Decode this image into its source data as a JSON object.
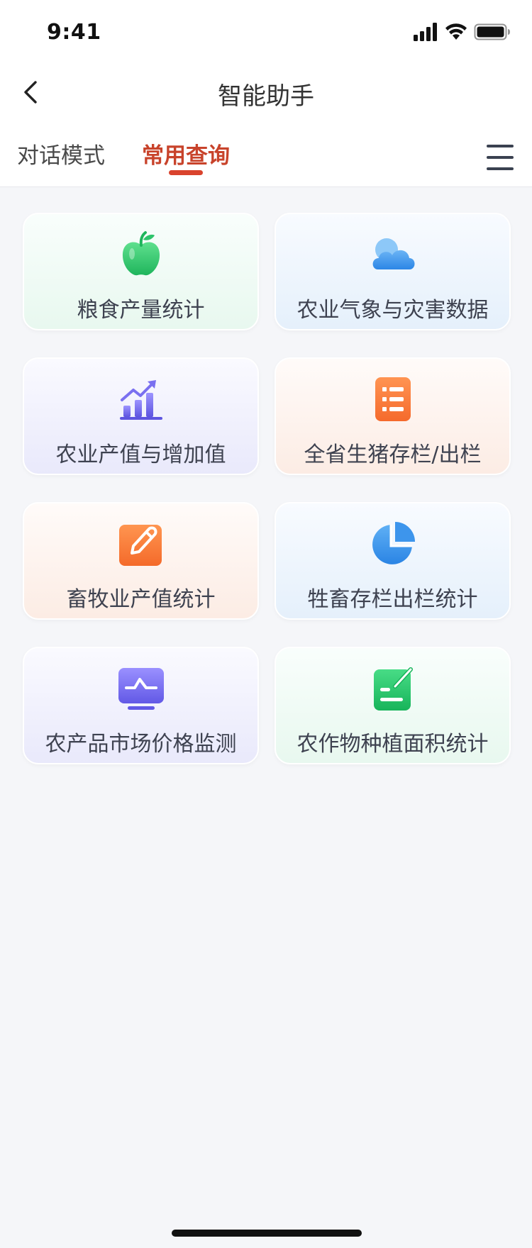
{
  "status_bar": {
    "time": "9:41"
  },
  "nav": {
    "title": "智能助手"
  },
  "tabs": [
    {
      "label": "对话模式",
      "active": false
    },
    {
      "label": "常用查询",
      "active": true
    }
  ],
  "colors": {
    "accent": "#d9432d",
    "page_bg": "#f5f6f9"
  },
  "cards": [
    {
      "label": "粮食产量统计",
      "icon": "apple-icon"
    },
    {
      "label": "农业气象与灾害数据",
      "icon": "cloud-icon"
    },
    {
      "label": "农业产值与增加值",
      "icon": "bar-chart-icon"
    },
    {
      "label": "全省生猪存栏/出栏",
      "icon": "list-icon"
    },
    {
      "label": "畜牧业产值统计",
      "icon": "edit-icon"
    },
    {
      "label": "牲畜存栏出栏统计",
      "icon": "pie-chart-icon"
    },
    {
      "label": "农产品市场价格监测",
      "icon": "monitor-icon"
    },
    {
      "label": "农作物种植面积统计",
      "icon": "form-edit-icon"
    }
  ]
}
